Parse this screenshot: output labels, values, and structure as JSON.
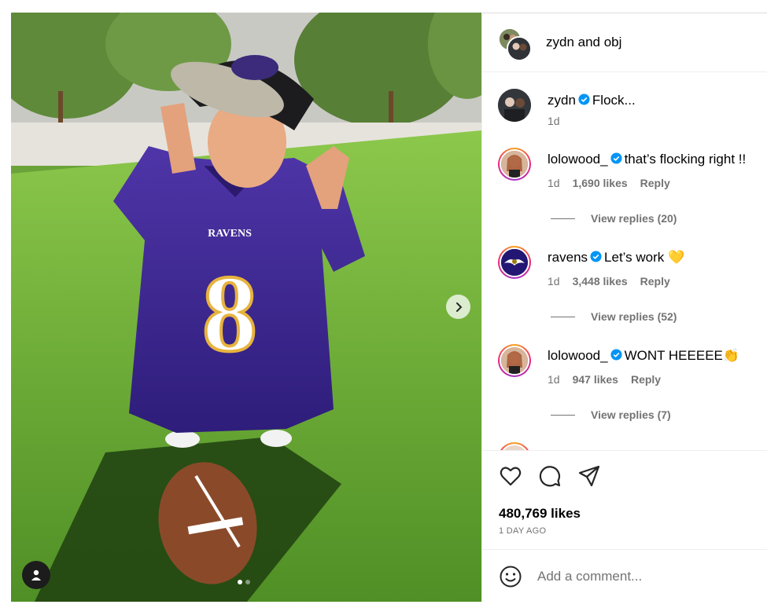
{
  "post": {
    "header_title": "zydn and obj",
    "likes": "480,769 likes",
    "date": "1 DAY AGO",
    "comment_placeholder": "Add a comment...",
    "caption": {
      "username": "zydn",
      "text": "Flock...",
      "time": "1d"
    }
  },
  "comments": [
    {
      "username": "lolowood_",
      "text": "that’s flocking right !!",
      "time": "1d",
      "likes": "1,690 likes",
      "reply": "Reply",
      "view_replies": "View replies (20)"
    },
    {
      "username": "ravens",
      "text": "Let’s work 💛",
      "time": "1d",
      "likes": "3,448 likes",
      "reply": "Reply",
      "view_replies": "View replies (52)"
    },
    {
      "username": "lolowood_",
      "text": "WONT HEEEEE👏",
      "time": "1d",
      "likes": "947 likes",
      "reply": "Reply",
      "view_replies": "View replies (7)"
    }
  ],
  "carousel": {
    "current": 1,
    "total": 2
  },
  "icons": [
    "heart-icon",
    "comment-icon",
    "share-icon",
    "emoji-icon",
    "verified-icon",
    "chevron-right-icon",
    "user-tag-icon"
  ],
  "colors": {
    "verified": "#0095f6",
    "muted": "#737373",
    "ravens_purple": "#4b2a8a"
  }
}
